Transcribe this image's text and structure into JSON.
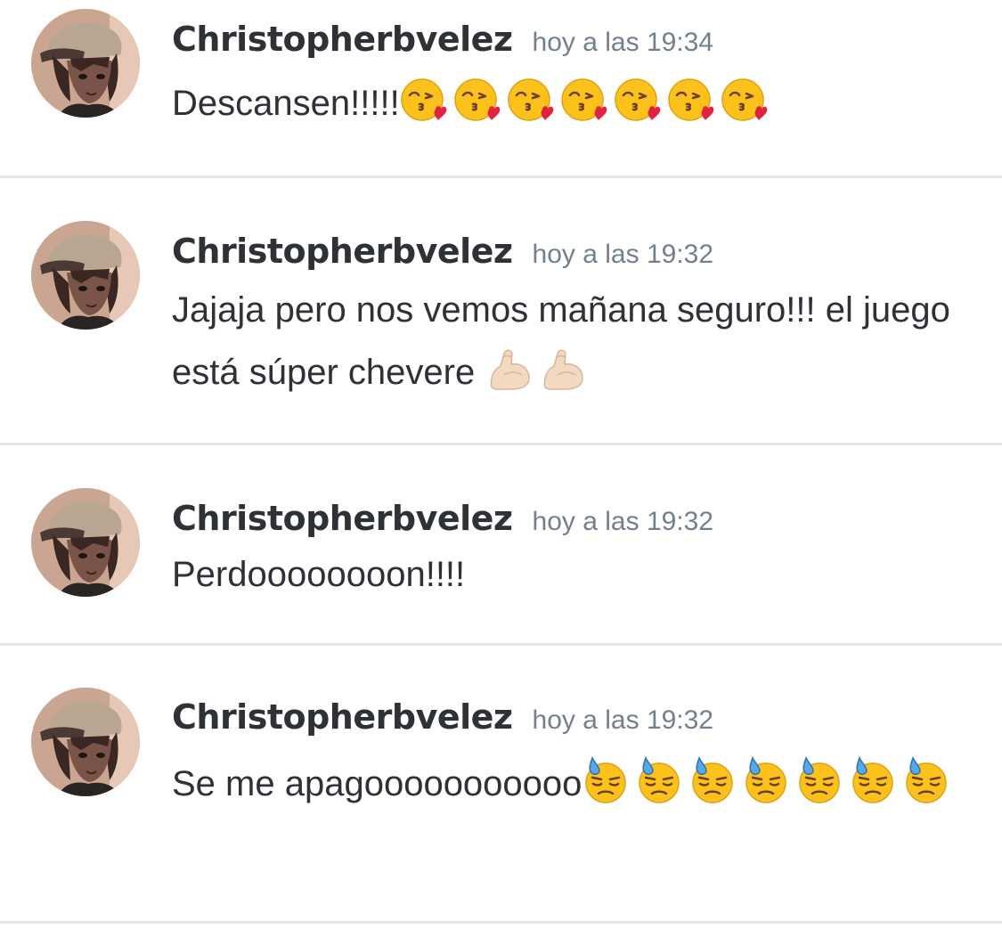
{
  "messages": [
    {
      "username": "Christopherbvelez",
      "timestamp": "hoy a las 19:34",
      "text": "Descansen!!!!!",
      "emojis": [
        "kissing-heart-icon",
        "kissing-heart-icon",
        "kissing-heart-icon",
        "kissing-heart-icon",
        "kissing-heart-icon",
        "kissing-heart-icon",
        "kissing-heart-icon"
      ]
    },
    {
      "username": "Christopherbvelez",
      "timestamp": "hoy a las 19:32",
      "text": "Jajaja pero nos vemos mañana seguro!!! el juego está súper chevere ",
      "emojis": [
        "flexed-biceps-icon",
        "flexed-biceps-icon"
      ]
    },
    {
      "username": "Christopherbvelez",
      "timestamp": "hoy a las 19:32",
      "text": "Perdoooooooon!!!!",
      "emojis": []
    },
    {
      "username": "Christopherbvelez",
      "timestamp": "hoy a las 19:32",
      "text": "Se me apagooooooooooo",
      "emojis": [
        "downcast-sweat-icon",
        "downcast-sweat-icon",
        "downcast-sweat-icon",
        "downcast-sweat-icon",
        "downcast-sweat-icon",
        "downcast-sweat-icon",
        "downcast-sweat-icon"
      ]
    }
  ],
  "colors": {
    "username": "#2e3136",
    "timestamp": "#747f8d",
    "body_text": "#2e3136",
    "divider": "#e3e5e8",
    "background": "#ffffff"
  }
}
